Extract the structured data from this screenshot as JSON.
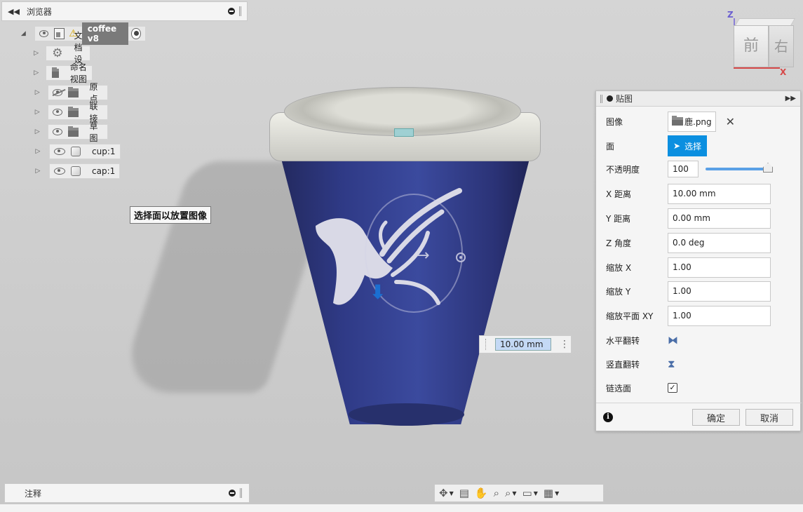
{
  "browser": {
    "title": "浏览器",
    "root": {
      "label": "coffee v8"
    },
    "items": [
      {
        "label": "文档设置",
        "icon": "gear-icon",
        "eye": "none"
      },
      {
        "label": "命名视图",
        "icon": "folder-icon",
        "eye": "none"
      },
      {
        "label": "原点",
        "icon": "folder-icon",
        "eye": "hidden"
      },
      {
        "label": "联接",
        "icon": "folder-icon",
        "eye": "visible"
      },
      {
        "label": "草图",
        "icon": "folder-icon",
        "eye": "visible"
      },
      {
        "label": "cup:1",
        "icon": "body-icon",
        "eye": "visible"
      },
      {
        "label": "cap:1",
        "icon": "body-icon",
        "eye": "visible"
      }
    ]
  },
  "tooltip": "选择面以放置图像",
  "dimension_input": "10.00 mm",
  "viewcube": {
    "front": "前",
    "right": "右",
    "axis_z": "Z",
    "axis_x": "X"
  },
  "decal_dialog": {
    "title": "贴图",
    "image_label": "图像",
    "image_file": "鹿.png",
    "face_label": "面",
    "select_button": "选择",
    "opacity_label": "不透明度",
    "opacity_value": "100",
    "x_distance_label": "X 距离",
    "x_distance_value": "10.00 mm",
    "y_distance_label": "Y 距离",
    "y_distance_value": "0.00 mm",
    "z_angle_label": "Z 角度",
    "z_angle_value": "0.0 deg",
    "scale_x_label": "缩放 X",
    "scale_x_value": "1.00",
    "scale_y_label": "缩放 Y",
    "scale_y_value": "1.00",
    "scale_xy_label": "缩放平面 XY",
    "scale_xy_value": "1.00",
    "flip_h_label": "水平翻转",
    "flip_v_label": "竖直翻转",
    "chain_faces_label": "链选面",
    "chain_faces_checked": "✓",
    "ok_button": "确定",
    "cancel_button": "取消"
  },
  "comments": {
    "title": "注释"
  },
  "colors": {
    "accent": "#0b8fe0",
    "cup_blue": "#2f3a86",
    "lid": "#e4e4de"
  }
}
